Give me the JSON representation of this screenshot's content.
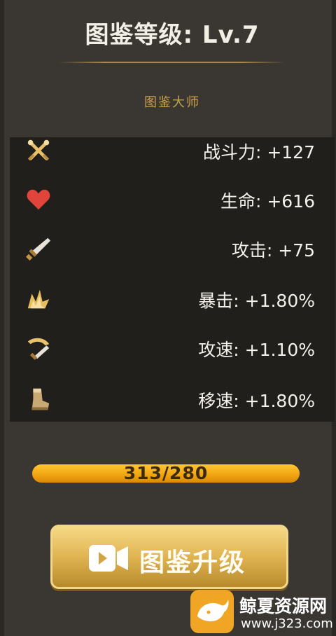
{
  "header": {
    "title": "图鉴等级: Lv.7",
    "subtitle": "图鉴大师"
  },
  "stats": [
    {
      "icon": "crossed-swords-icon",
      "label": "战斗力: +127"
    },
    {
      "icon": "heart-icon",
      "label": "生命: +616"
    },
    {
      "icon": "sword-icon",
      "label": "攻击: +75"
    },
    {
      "icon": "crit-burst-icon",
      "label": "暴击: +1.80%"
    },
    {
      "icon": "attack-speed-icon",
      "label": "攻速: +1.10%"
    },
    {
      "icon": "boot-icon",
      "label": "移速: +1.80%"
    }
  ],
  "progress": {
    "text": "313/280",
    "fraction": 1.0
  },
  "upgrade": {
    "label": "图鉴升级",
    "icon": "video-camera-icon"
  },
  "watermark": {
    "name": "鲸夏资源网",
    "url": "www.j323.com"
  },
  "colors": {
    "accent": "#c9a24c",
    "progress": "#f0a20f",
    "button": "#e0b451",
    "heart": "#e0443a",
    "panel": "#3a3732"
  }
}
